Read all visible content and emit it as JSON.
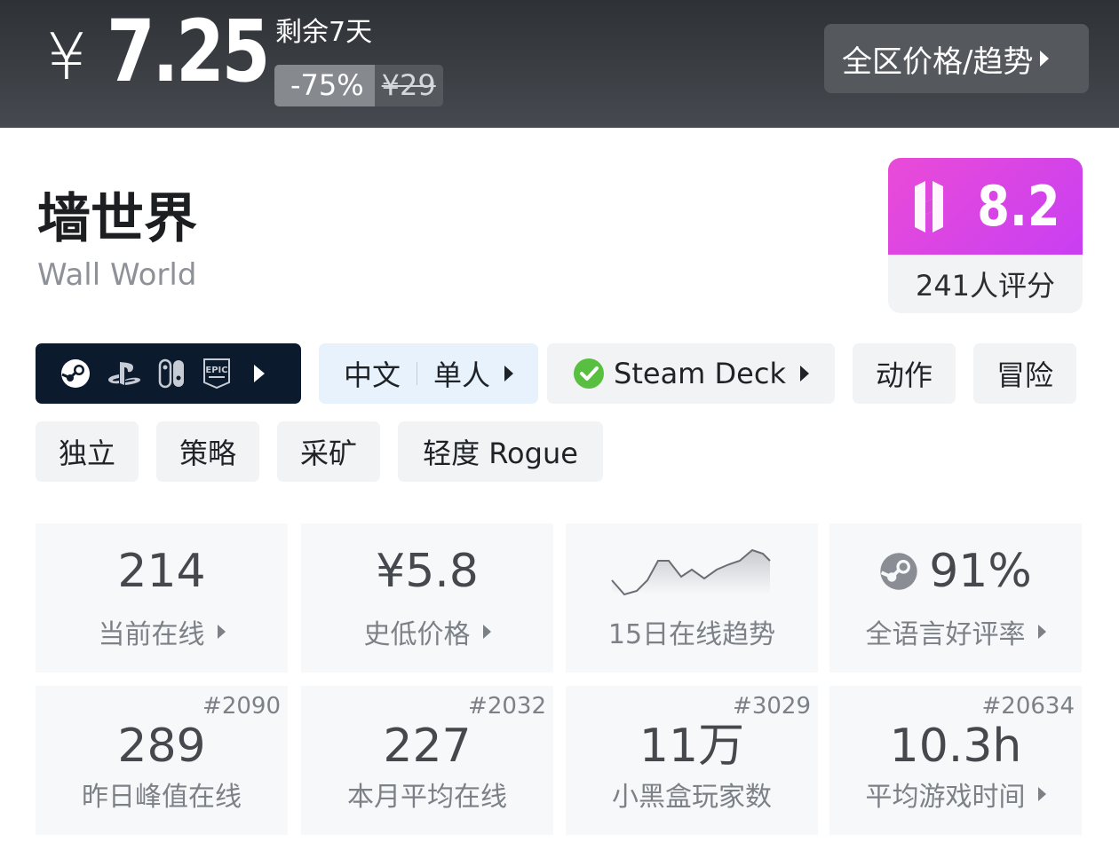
{
  "price": {
    "currency": "¥",
    "current": "7.25",
    "days_left": "剩余7天",
    "discount": "-75%",
    "original": "¥29",
    "region_button": "全区价格/趋势"
  },
  "game": {
    "title_zh": "墙世界",
    "title_en": "Wall World"
  },
  "score": {
    "value": "8.2",
    "count": "241人评分",
    "accent_color": "#e04bdc"
  },
  "platforms": {
    "icons": [
      "steam-icon",
      "playstation-icon",
      "switch-icon",
      "epic-games-icon"
    ]
  },
  "tags": {
    "language": "中文",
    "mode": "单人",
    "steam_deck": "Steam Deck",
    "genres": [
      "动作",
      "冒险",
      "独立",
      "策略",
      "采矿",
      "轻度 Rogue"
    ]
  },
  "stats": {
    "row1": [
      {
        "value": "214",
        "label": "当前在线"
      },
      {
        "value": "¥5.8",
        "label": "史低价格"
      },
      {
        "label": "15日在线趋势"
      },
      {
        "value": "91%",
        "label": "全语言好评率"
      }
    ],
    "row2": [
      {
        "value": "289",
        "label": "昨日峰值在线",
        "rank": "#2090"
      },
      {
        "value": "227",
        "label": "本月平均在线",
        "rank": "#2032"
      },
      {
        "value": "11万",
        "label": "小黑盒玩家数",
        "rank": "#3029"
      },
      {
        "value": "10.3h",
        "label": "平均游戏时间",
        "rank": "#20634"
      }
    ]
  }
}
